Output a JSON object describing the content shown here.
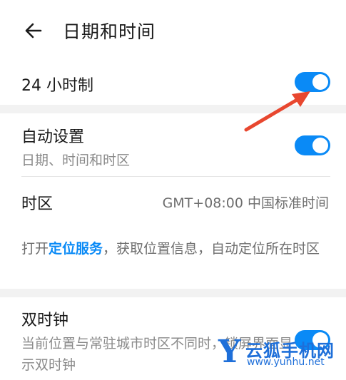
{
  "header": {
    "title": "日期和时间",
    "back_icon": "arrow-left-icon"
  },
  "hour24": {
    "label": "24 小时制",
    "enabled": true
  },
  "auto": {
    "label": "自动设置",
    "subtitle": "日期、时间和时区",
    "enabled": true
  },
  "timezone": {
    "label": "时区",
    "value": "GMT+08:00 中国标准时间"
  },
  "location_info": {
    "prefix": "打开",
    "link": "定位服务",
    "suffix": "，获取位置信息，自动定位所在时区"
  },
  "dual_clock": {
    "label": "双时钟",
    "subtitle": "当前位置与常驻城市时区不同时，锁屏界面显示双时钟",
    "enabled": true
  },
  "annotation": {
    "arrow_color": "#e8472f"
  },
  "watermark": {
    "name": "云狐手机网",
    "url": "www.yunhu.net",
    "logo": "Y"
  },
  "colors": {
    "accent": "#0a8af6"
  }
}
